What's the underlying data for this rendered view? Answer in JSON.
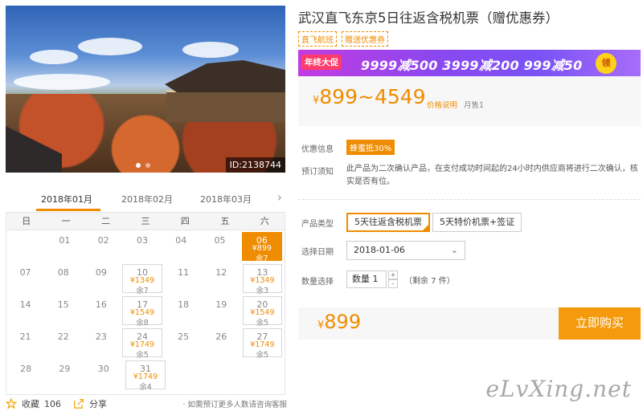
{
  "gallery": {
    "image_id": "ID:2138744",
    "alt": "清水寺红叶景观"
  },
  "calendar": {
    "months": [
      "2018年01月",
      "2018年02月",
      "2018年03月"
    ],
    "next_icon": "chevron-right-icon",
    "weekdays": [
      "日",
      "一",
      "二",
      "三",
      "四",
      "五",
      "六"
    ],
    "rows": [
      [
        {
          "d": ""
        },
        {
          "d": "01"
        },
        {
          "d": "02"
        },
        {
          "d": "03"
        },
        {
          "d": "04"
        },
        {
          "d": "05"
        },
        {
          "d": "06",
          "p": "¥899",
          "r": "余7",
          "sel": true
        }
      ],
      [
        {
          "d": "07"
        },
        {
          "d": "08"
        },
        {
          "d": "09"
        },
        {
          "d": "10",
          "p": "¥1349",
          "r": "余7"
        },
        {
          "d": "11"
        },
        {
          "d": "12"
        },
        {
          "d": "13",
          "p": "¥1349",
          "r": "余3"
        }
      ],
      [
        {
          "d": "14"
        },
        {
          "d": "15"
        },
        {
          "d": "16"
        },
        {
          "d": "17",
          "p": "¥1549",
          "r": "余8"
        },
        {
          "d": "18"
        },
        {
          "d": "19"
        },
        {
          "d": "20",
          "p": "¥1549",
          "r": "余5"
        }
      ],
      [
        {
          "d": "21"
        },
        {
          "d": "22"
        },
        {
          "d": "23"
        },
        {
          "d": "24",
          "p": "¥1749",
          "r": "余5"
        },
        {
          "d": "25"
        },
        {
          "d": "26"
        },
        {
          "d": "27",
          "p": "¥1749",
          "r": "余5"
        }
      ],
      [
        {
          "d": "28"
        },
        {
          "d": "29"
        },
        {
          "d": "30"
        },
        {
          "d": "31",
          "p": "¥1749",
          "r": "余4"
        },
        {
          "d": ""
        },
        {
          "d": ""
        },
        {
          "d": ""
        }
      ]
    ]
  },
  "actions": {
    "fav_label": "收藏",
    "fav_count": "106",
    "share_label": "分享",
    "hint": "· 如需预订更多人数请咨询客服"
  },
  "product": {
    "title": "武汉直飞东京5日往返含税机票（赠优惠券）",
    "tags": [
      "直飞航班",
      "赠送优惠券"
    ],
    "promo": {
      "badge": "年终大促",
      "text": "9999减500  3999减200  999减50",
      "coin": "领"
    },
    "price_range": "899~4549",
    "currency": "¥",
    "price_note": "价格说明",
    "sold": "月售1"
  },
  "info": {
    "discount_label": "优惠信息",
    "discount_badge": "蜂蜜抵30%",
    "notice_label": "预订须知",
    "notice_text": "此产品为二次确认产品，在支付成功时间起的24小时内供应商将进行二次确认，核实是否有位。"
  },
  "options": {
    "type_label": "产品类型",
    "types": [
      "5天往返含税机票",
      "5天特价机票+签证"
    ],
    "date_label": "选择日期",
    "date_value": "2018-01-06",
    "qty_label": "数量选择",
    "qty_value": "数量  1",
    "remain": "（剩余 7 件）"
  },
  "buy": {
    "total": "899",
    "button": "立即购买"
  },
  "watermark": "eLvXing.net",
  "colors": {
    "accent": "#f08c00",
    "buy_button": "#f59a0c"
  }
}
